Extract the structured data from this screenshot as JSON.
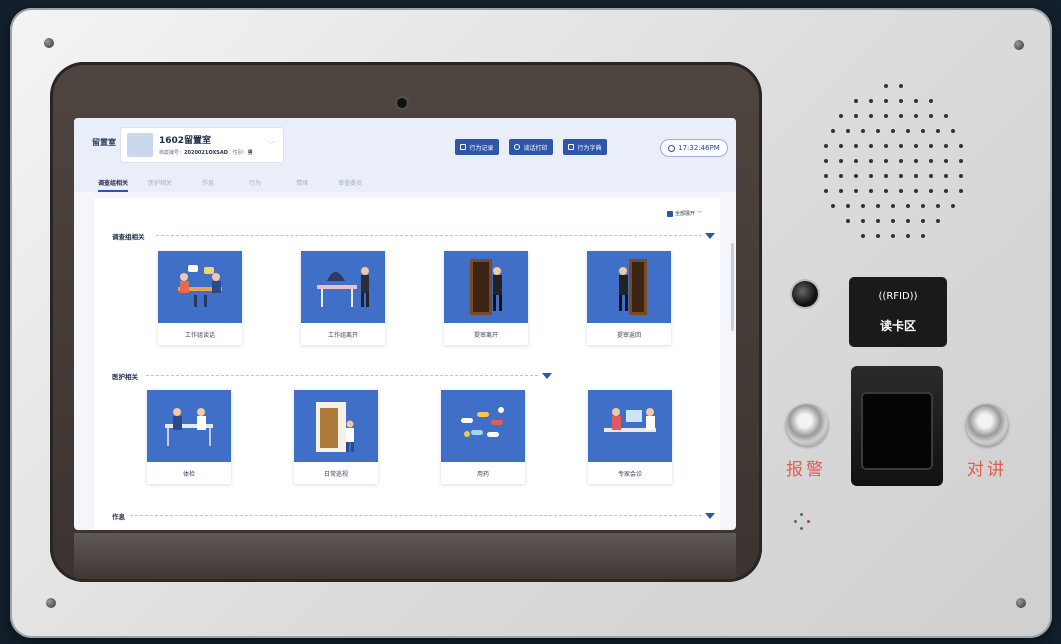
{
  "header": {
    "room_label": "留置室",
    "profile_name": "1602留置室",
    "profile_id_label": "档案编号：",
    "profile_id_value": "2020021OXSAD",
    "profile_gender_label": "性别：",
    "profile_gender_value": "男",
    "buttons": [
      {
        "label": "行为记录",
        "icon": "edit-icon"
      },
      {
        "label": "谈话打印",
        "icon": "print-icon"
      },
      {
        "label": "行为字典",
        "icon": "book-icon"
      }
    ],
    "clock": "17:32:46PM"
  },
  "tabs": [
    "调查组相关",
    "医护相关",
    "作息",
    "行为",
    "情绪",
    "审查委员"
  ],
  "expand_all_label": "全部展开",
  "sections": [
    {
      "title": "调查组相关",
      "items": [
        {
          "label": "工作组谈话",
          "icon": "meeting-icon"
        },
        {
          "label": "工作组离开",
          "icon": "leaving-icon"
        },
        {
          "label": "提审离开",
          "icon": "door-exit-icon"
        },
        {
          "label": "提审返回",
          "icon": "door-return-icon"
        }
      ]
    },
    {
      "title": "医护相关",
      "items": [
        {
          "label": "体检",
          "icon": "medical-check-icon"
        },
        {
          "label": "日常巡视",
          "icon": "patrol-icon"
        },
        {
          "label": "用药",
          "icon": "pills-icon"
        },
        {
          "label": "专家会诊",
          "icon": "consultation-icon"
        }
      ]
    },
    {
      "title": "作息",
      "items": []
    }
  ],
  "panel": {
    "rfid_symbol": "((RFID))",
    "rfid_label": "读卡区",
    "alarm_label": "报警",
    "intercom_label": "对讲"
  }
}
